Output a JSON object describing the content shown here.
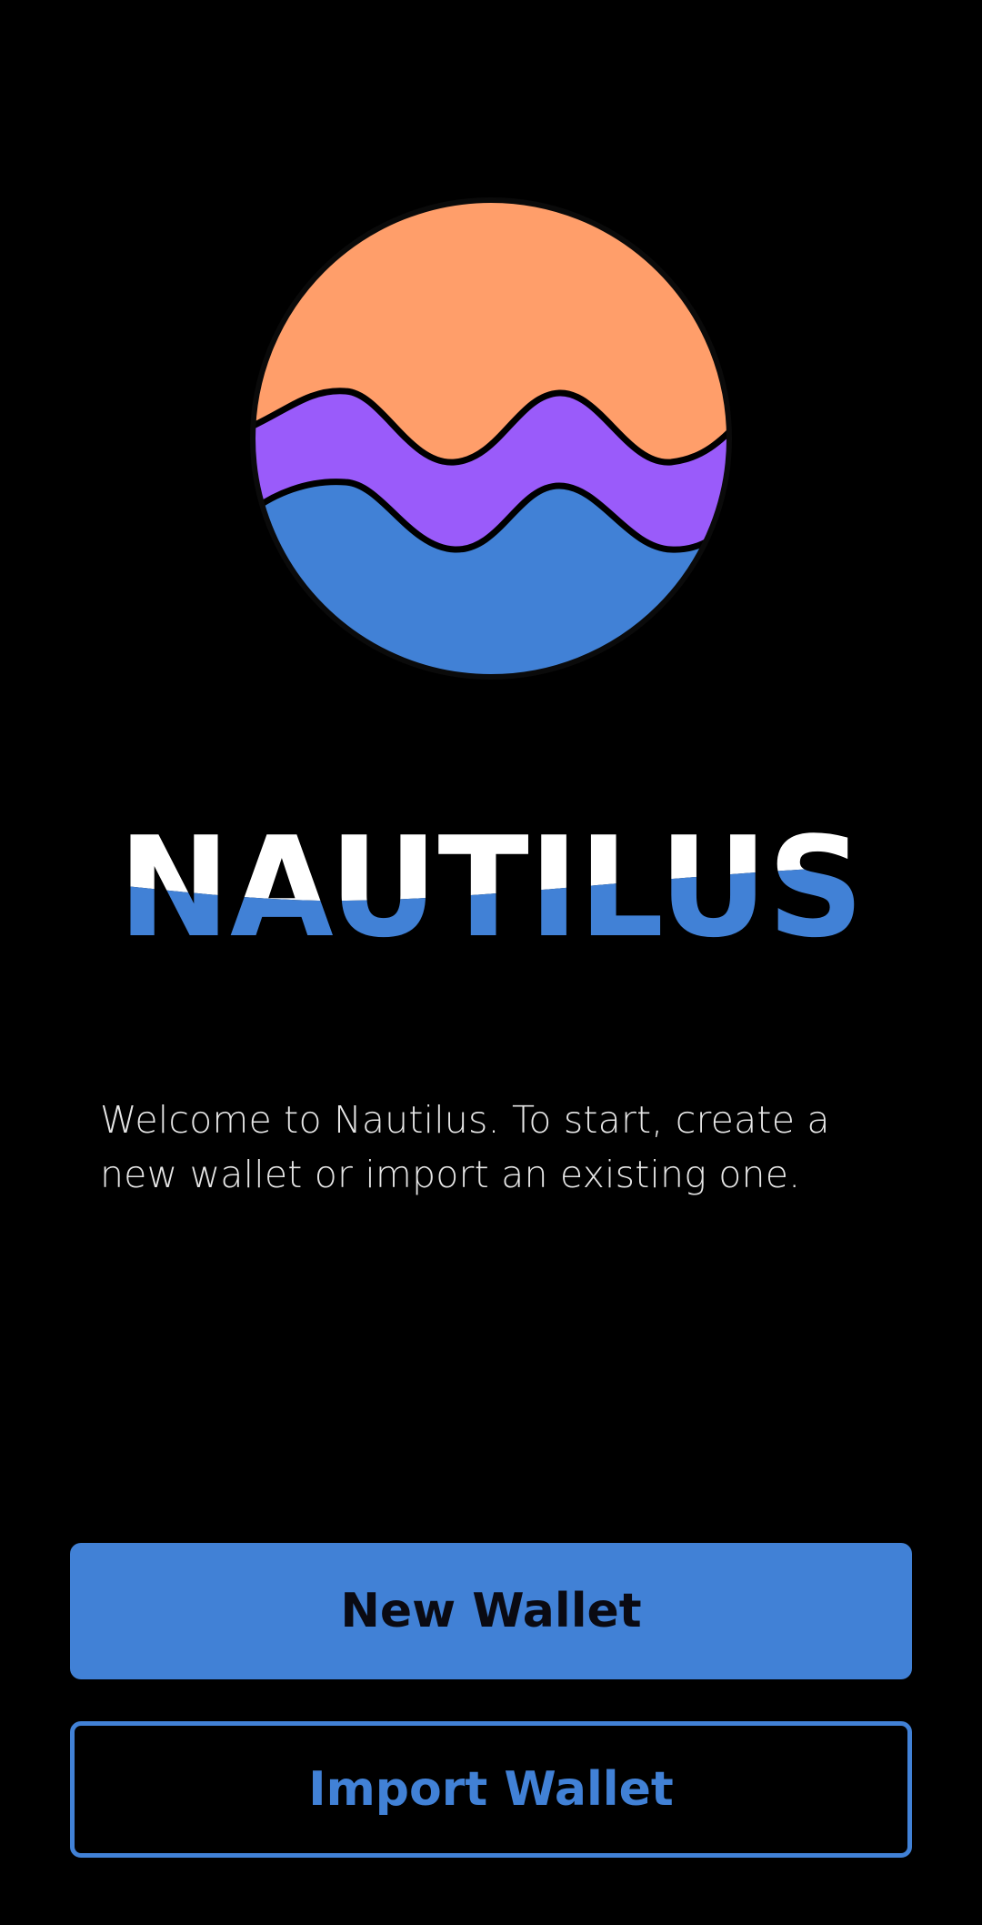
{
  "brand": {
    "logo_icon": "nautilus-sun-waves-logo",
    "wordmark": "NAUTILUS"
  },
  "welcome": {
    "text": "Welcome to Nautilus. To start, create a new wallet or import an existing one."
  },
  "actions": {
    "new_wallet_label": "New Wallet",
    "import_wallet_label": "Import Wallet"
  },
  "colors": {
    "background": "#000000",
    "accent": "#4181D6",
    "logo_orange": "#FF9E6A",
    "logo_purple": "#9A5BFA",
    "logo_blue": "#4181D6",
    "wordmark_white": "#FFFFFF"
  }
}
